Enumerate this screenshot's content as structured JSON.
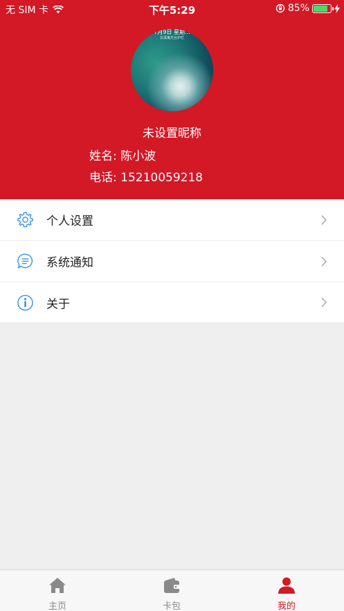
{
  "status_bar": {
    "carrier": "无 SIM 卡",
    "time": "下午5:29",
    "battery": "85%",
    "battery_level": 0.85
  },
  "profile": {
    "avatar_text": "7月9日 星期...",
    "avatar_subtext": "云溪鬼光台护栏",
    "nickname": "未设置昵称",
    "name_label": "姓名:",
    "name_value": "陈小波",
    "phone_label": "电话:",
    "phone_value": "15210059218"
  },
  "menu": [
    {
      "label": "个人设置",
      "icon": "gear-icon"
    },
    {
      "label": "系统通知",
      "icon": "message-icon"
    },
    {
      "label": "关于",
      "icon": "info-icon"
    }
  ],
  "tabbar": [
    {
      "label": "主页",
      "icon": "home-icon"
    },
    {
      "label": "卡包",
      "icon": "wallet-icon"
    },
    {
      "label": "我的",
      "icon": "user-icon"
    }
  ],
  "colors": {
    "brand_red": "#d31826",
    "icon_blue": "#2f8fe0",
    "tab_inactive": "#888888"
  }
}
